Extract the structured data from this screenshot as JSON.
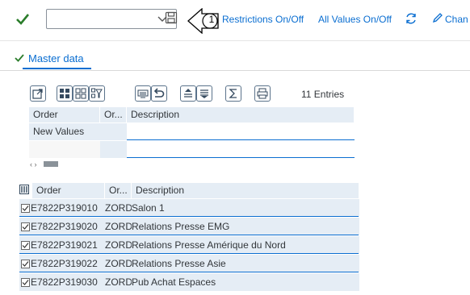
{
  "toolbar": {
    "variant_value": "",
    "callout_number": "1",
    "restrictions_label": "Restrictions On/Off",
    "all_values_label": "All Values On/Off",
    "change_label": "Chan",
    "accent_color": "#0a6ed1",
    "check_color": "#2b7d2b"
  },
  "tab": {
    "label": "Master data"
  },
  "grid_toolbar": {
    "icons": [
      "export-icon",
      "select-all-icon",
      "deselect-all-icon",
      "filter-icon",
      "print-preview-icon",
      "undo-icon",
      "align-left-icon",
      "align-justify-icon",
      "sum-icon",
      "print-icon"
    ],
    "entries_text": "11 Entries"
  },
  "top_table": {
    "columns": [
      "Order",
      "Or...",
      "Description"
    ],
    "rows": [
      {
        "order": "New Values",
        "ord_type": "",
        "description": ""
      },
      {
        "order": "",
        "ord_type": "",
        "description": ""
      }
    ]
  },
  "bottom_table": {
    "columns": [
      "Order",
      "Or...",
      "Description"
    ],
    "rows": [
      {
        "order": "E7822P319010",
        "ord_type": "ZORD",
        "description": "Salon 1",
        "checked": true
      },
      {
        "order": "E7822P319020",
        "ord_type": "ZORD",
        "description": "Relations Presse EMG",
        "checked": true
      },
      {
        "order": "E7822P319021",
        "ord_type": "ZORD",
        "description": "Relations Presse Amérique du Nord",
        "checked": true
      },
      {
        "order": "E7822P319022",
        "ord_type": "ZORD",
        "description": "Relations Presse Asie",
        "checked": true
      },
      {
        "order": "E7822P319030",
        "ord_type": "ZORD",
        "description": "Pub Achat Espaces",
        "checked": true
      }
    ]
  }
}
